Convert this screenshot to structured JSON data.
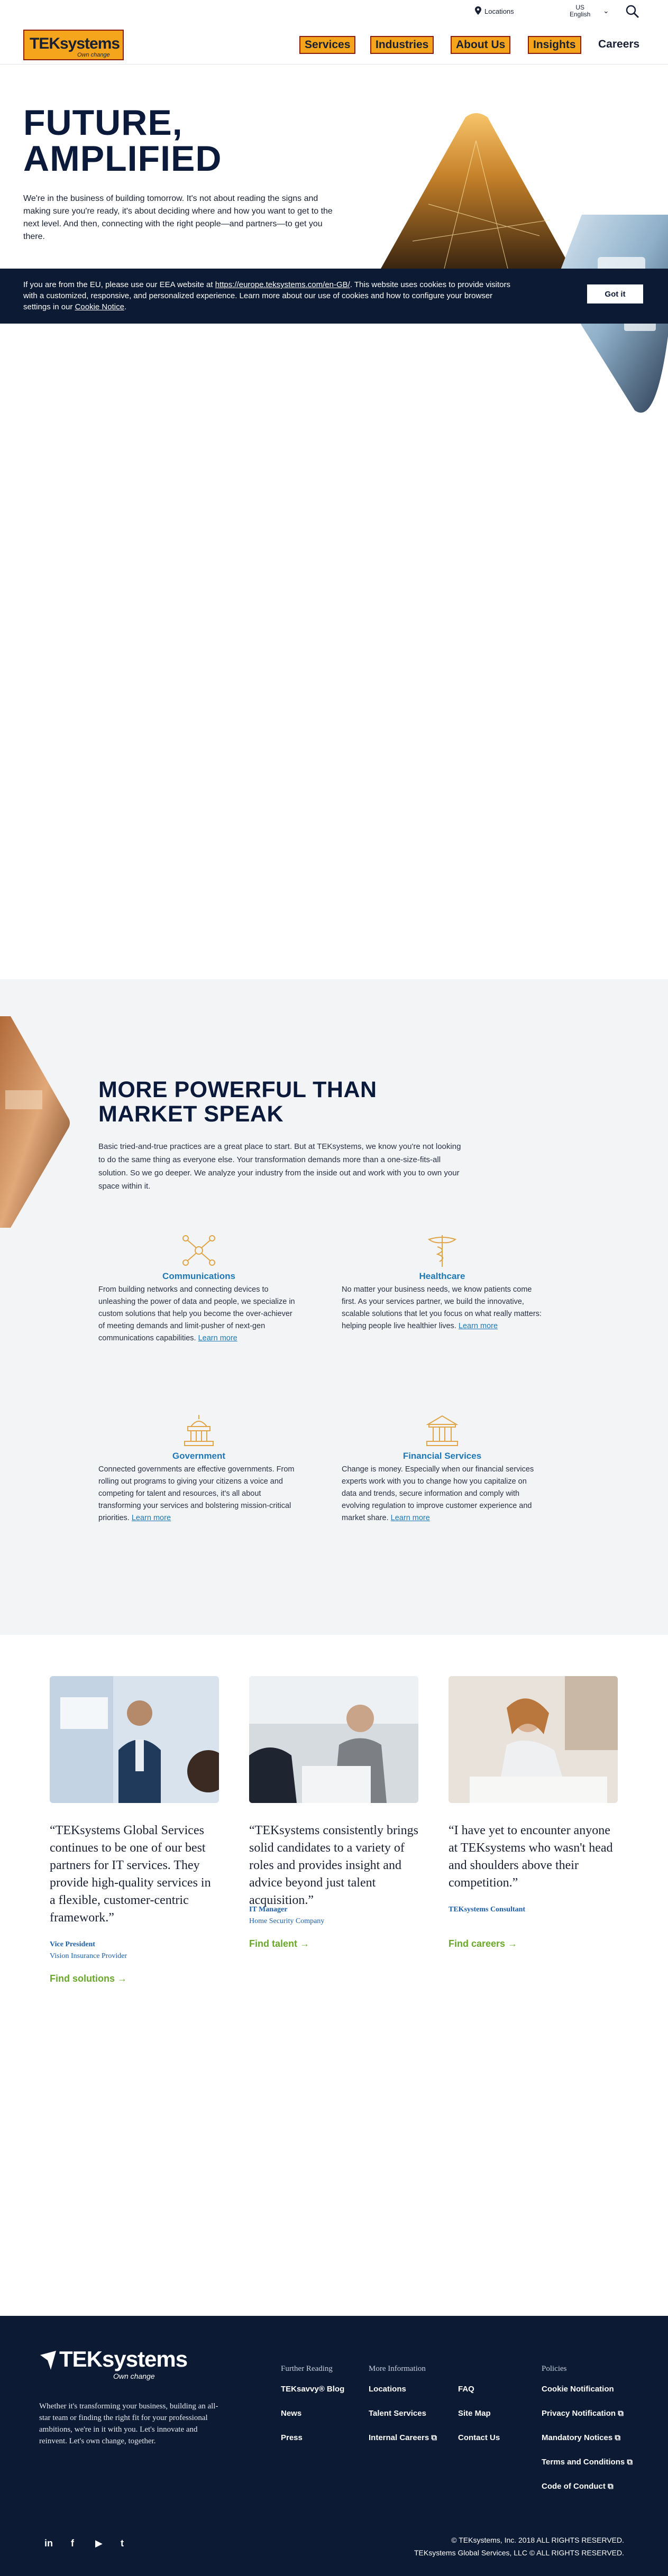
{
  "utility": {
    "locations": "Locations",
    "lang_top": "US",
    "lang_bottom": "English"
  },
  "nav": {
    "logo_text": "TEKsystems",
    "logo_tagline": "Own change",
    "items": [
      "Services",
      "Industries",
      "About Us",
      "Insights"
    ],
    "careers": "Careers"
  },
  "hero": {
    "title_line1": "FUTURE,",
    "title_line2": "AMPLIFIED",
    "text": "We're in the business of building tomorrow. It's not about reading the signs and making sure you're ready, it's about deciding where and how you want to get to the next level. And then, connecting with the right people—and partners—to get you there."
  },
  "cookie": {
    "text_before": "If you are from the EU, please use our EEA website at ",
    "link": "https://europe.teksystems.com/en-GB/",
    "text_after": ". This website uses cookies to provide visitors with a customized, responsive, and personalized experience. Learn more about our use of cookies and how to configure your browser settings in our ",
    "notice": "Cookie Notice",
    "end": ".",
    "button": "Got it"
  },
  "powerful": {
    "title_line1": "MORE POWERFUL THAN",
    "title_line2": "MARKET SPEAK",
    "text": "Basic tried-and-true practices are a great place to start. But at TEKsystems, we know you're not looking to do the same thing as everyone else. Your transformation demands more than a one-size-fits-all solution. So we go deeper. We analyze your industry from the inside out and work with you to own your space within it.",
    "learn_more": "Learn more",
    "industries": [
      {
        "title": "Communications",
        "text": "From building networks and connecting devices to unleashing the power of data and people, we specialize in custom solutions that help you become the over-achiever of meeting demands and limit-pusher of next-gen communications capabilities. "
      },
      {
        "title": "Healthcare",
        "text": "No matter your business needs, we know patients come first. As your services partner, we build the innovative, scalable solutions that let you focus on what really matters: helping people live healthier lives. "
      },
      {
        "title": "Government",
        "text": "Connected governments are effective governments. From rolling out programs to giving your citizens a voice and competing for talent and resources, it's all about transforming your services and bolstering mission-critical priorities. "
      },
      {
        "title": "Financial Services",
        "text": "Change is money. Especially when our financial services experts work with you to change how you capitalize on data and trends, secure information and comply with evolving regulation to improve customer experience and market share. "
      }
    ]
  },
  "testimonials": [
    {
      "quote": "“TEKsystems Global Services continues to be one of our best partners for IT services. They provide high-quality services in a flexible, customer-centric framework.”",
      "role": "Vice President",
      "org": "Vision Insurance Provider",
      "cta": "Find solutions →"
    },
    {
      "quote": "“TEKsystems consistently brings solid candidates to a variety of roles and provides insight and advice beyond just talent acquisition.”",
      "role": "IT Manager",
      "org": "Home Security Company",
      "cta": "Find talent →"
    },
    {
      "quote": "“I have yet to encounter anyone at TEKsystems who wasn't head and shoulders above their competition.”",
      "role": "TEKsystems Consultant",
      "org": "",
      "cta": "Find careers →"
    }
  ],
  "footer": {
    "logo_text": "TEKsystems",
    "logo_tagline": "Own change",
    "blurb": "Whether it's transforming your business, building an all-star team or finding the right fit for your professional ambitions, we're in it with you. Let's innovate and reinvent. Let's own change, together.",
    "col1": {
      "heading": "Further Reading",
      "links": [
        "TEKsavvy® Blog",
        "News",
        "Press"
      ]
    },
    "col2": {
      "heading": "More Information",
      "links": [
        "Locations",
        "Talent Services",
        "Internal Careers ⧉"
      ]
    },
    "col3": {
      "links": [
        "FAQ",
        "Site Map",
        "Contact Us"
      ]
    },
    "col4": {
      "heading": "Policies",
      "links": [
        "Cookie Notification",
        "Privacy Notification ⧉",
        "Mandatory Notices ⧉",
        "Terms and Conditions ⧉",
        "Code of Conduct ⧉"
      ]
    },
    "social": [
      "in",
      "f",
      "▶",
      "t"
    ],
    "copy1": "© TEKsystems, Inc. 2018 ALL RIGHTS RESERVED.",
    "copy2": "TEKsystems Global Services, LLC © ALL RIGHTS RESERVED."
  }
}
